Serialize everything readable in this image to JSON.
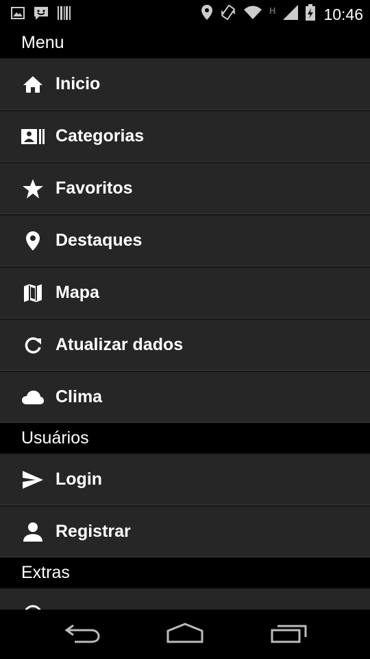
{
  "status_bar": {
    "time": "10:46",
    "network_badge": "H",
    "left_icons": [
      "image-notification-icon",
      "chat-notification-icon",
      "barcode-notification-icon"
    ],
    "right_icons": [
      "location-icon",
      "vibrate-icon",
      "wifi-icon",
      "signal-icon",
      "battery-charging-icon"
    ]
  },
  "sections": {
    "menu": {
      "title": "Menu",
      "items": [
        {
          "label": "Inicio",
          "icon": "home-icon"
        },
        {
          "label": "Categorias",
          "icon": "categories-icon"
        },
        {
          "label": "Favoritos",
          "icon": "star-icon"
        },
        {
          "label": "Destaques",
          "icon": "map-pin-icon"
        },
        {
          "label": "Mapa",
          "icon": "map-icon"
        },
        {
          "label": "Atualizar dados",
          "icon": "refresh-icon"
        },
        {
          "label": "Clima",
          "icon": "cloud-icon"
        }
      ]
    },
    "users": {
      "title": "Usuários",
      "items": [
        {
          "label": "Login",
          "icon": "send-icon"
        },
        {
          "label": "Registrar",
          "icon": "person-icon"
        }
      ]
    },
    "extras": {
      "title": "Extras"
    }
  },
  "nav_bar": {
    "buttons": [
      "back-icon",
      "home-nav-icon",
      "recents-icon"
    ]
  },
  "colors": {
    "item_background": "#262626",
    "section_background": "#000000",
    "text": "#ffffff"
  }
}
